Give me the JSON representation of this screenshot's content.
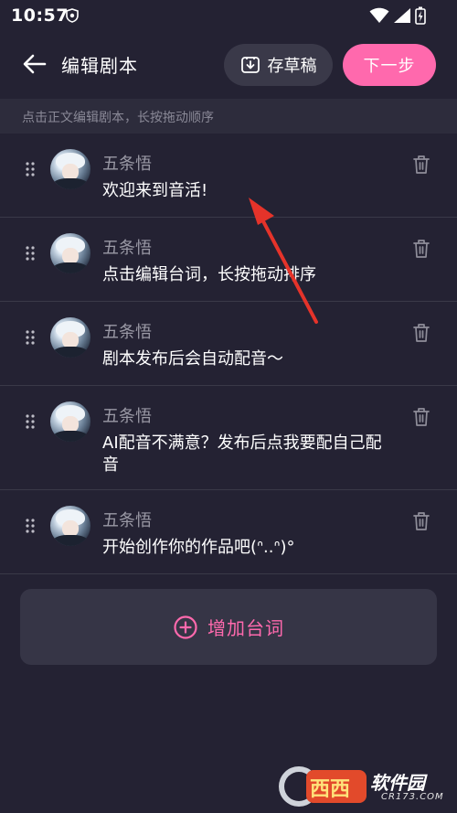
{
  "status_bar": {
    "time": "10:57",
    "icons": [
      "vpn-shield-icon",
      "wifi-icon",
      "signal-icon",
      "battery-charging-icon"
    ]
  },
  "header": {
    "title": "编辑剧本",
    "draft_label": "存草稿",
    "next_label": "下一步"
  },
  "hint": "点击正文编辑剧本，长按拖动顺序",
  "script_lines": [
    {
      "speaker": "五条悟",
      "text": "欢迎来到音活!"
    },
    {
      "speaker": "五条悟",
      "text": "点击编辑台词，长按拖动排序"
    },
    {
      "speaker": "五条悟",
      "text": "剧本发布后会自动配音～"
    },
    {
      "speaker": "五条悟",
      "text": "AI配音不满意？发布后点我要配自己配音"
    },
    {
      "speaker": "五条悟",
      "text": "开始创作你的作品吧(ᐢ..ᐢ)°"
    }
  ],
  "add_line_label": "增加台词",
  "watermark": {
    "badge": "西西",
    "brand": "软件园",
    "domain": "CR173.COM"
  },
  "colors": {
    "background": "#242233",
    "accent_pink": "#ff69ad",
    "card": "#363546",
    "muted_text": "#9a99a5"
  }
}
